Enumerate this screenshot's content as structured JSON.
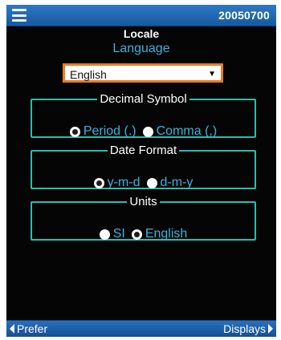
{
  "header": {
    "menu_icon": "hamburger-menu-icon",
    "serial": "20050700"
  },
  "page": {
    "title": "Locale",
    "language_label": "Language",
    "language_select": {
      "value": "English",
      "arrow": "▼"
    }
  },
  "decimal_symbol": {
    "legend": "Decimal Symbol",
    "options": [
      {
        "label": "Period (.)",
        "checked": true
      },
      {
        "label": "Comma (,)",
        "checked": false
      }
    ]
  },
  "date_format": {
    "legend": "Date Format",
    "options": [
      {
        "label": "y-m-d",
        "checked": true
      },
      {
        "label": "d-m-y",
        "checked": false
      }
    ]
  },
  "units": {
    "legend": "Units",
    "options": [
      {
        "label": "SI",
        "checked": false
      },
      {
        "label": "English",
        "checked": true
      }
    ]
  },
  "footer": {
    "prev_label": "Prefer",
    "next_label": "Displays"
  },
  "colors": {
    "accent_text": "#3ab3dc",
    "border": "#2bbcad",
    "select_border": "#e67e22",
    "bar_blue": "#2f78c8"
  }
}
